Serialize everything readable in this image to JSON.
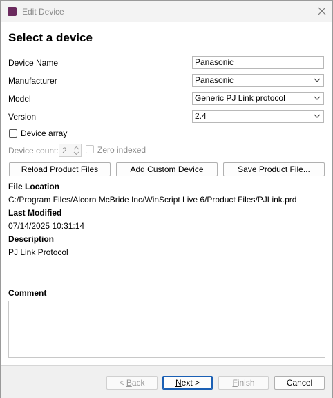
{
  "window": {
    "title": "Edit Device"
  },
  "heading": "Select a device",
  "fields": {
    "device_name": {
      "label": "Device Name",
      "value": "Panasonic"
    },
    "manufacturer": {
      "label": "Manufacturer",
      "value": "Panasonic"
    },
    "model": {
      "label": "Model",
      "value": "Generic PJ Link protocol"
    },
    "version": {
      "label": "Version",
      "value": "2.4"
    }
  },
  "device_array": {
    "label": "Device array",
    "checked": false
  },
  "device_count": {
    "label": "Device count:",
    "value": "2"
  },
  "zero_indexed": {
    "label": "Zero indexed",
    "checked": false
  },
  "buttons": {
    "reload": "Reload Product Files",
    "add_custom": "Add Custom Device",
    "save_product": "Save Product File..."
  },
  "info": {
    "file_location_label": "File Location",
    "file_location_value": "C:/Program Files/Alcorn McBride Inc/WinScript Live 6/Product Files/PJLink.prd",
    "last_modified_label": "Last Modified",
    "last_modified_value": "07/14/2025 10:31:14",
    "description_label": "Description",
    "description_value": "PJ Link Protocol"
  },
  "comment": {
    "label": "Comment",
    "value": ""
  },
  "footer": {
    "back": {
      "prefix": "< ",
      "mnemonic": "B",
      "rest": "ack"
    },
    "next": {
      "mnemonic": "N",
      "rest": "ext >"
    },
    "finish": {
      "mnemonic": "F",
      "rest": "inish"
    },
    "cancel": "Cancel"
  }
}
